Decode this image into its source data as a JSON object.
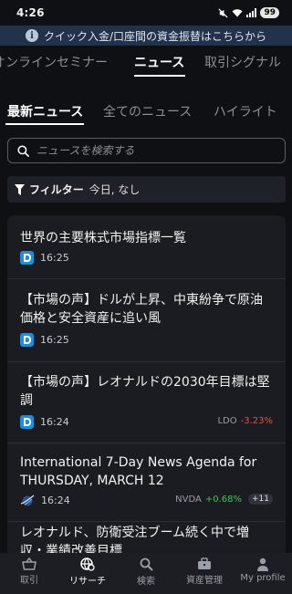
{
  "status_bar": {
    "time": "4:26",
    "battery": "99"
  },
  "banner": {
    "text": "クイック入金/口座間の資金振替はこちらから",
    "icon": "info-icon"
  },
  "top_tabs": [
    {
      "label": "オンラインセミナー"
    },
    {
      "label": "ニュース",
      "active": true
    },
    {
      "label": "取引シグナル"
    }
  ],
  "sub_tabs": [
    {
      "label": "最新ニュース",
      "active": true
    },
    {
      "label": "全てのニュース"
    },
    {
      "label": "ハイライト"
    }
  ],
  "search": {
    "placeholder": "ニュースを検索する"
  },
  "filter": {
    "label": "フィルター",
    "value": "今日, なし"
  },
  "news": [
    {
      "title": "世界の主要株式市場指標一覧",
      "time": "16:25",
      "source_icon": "news-source-icon"
    },
    {
      "title": "【市場の声】ドルが上昇、中東紛争で原油価格と安全資産に追い風",
      "time": "16:25",
      "source_icon": "news-source-icon"
    },
    {
      "title": "【市場の声】レオナルドの2030年目標は堅調",
      "time": "16:24",
      "source_icon": "news-source-icon",
      "ticker": "LDO",
      "change": "-3.23%"
    },
    {
      "title": "International 7-Day News Agenda for THURSDAY, MARCH 12",
      "time": "16:24",
      "source_icon": "globe-source-icon",
      "ticker": "NVDA",
      "change": "+0.68%",
      "more": "+11"
    },
    {
      "title": "レオナルド、防衛受注ブーム続く中で増収・業績改善目標"
    }
  ],
  "bottom_nav": [
    {
      "label": "取引",
      "icon": "basket-icon"
    },
    {
      "label": "リサーチ",
      "icon": "research-globe-icon",
      "active": true
    },
    {
      "label": "検索",
      "icon": "search-icon"
    },
    {
      "label": "資産管理",
      "icon": "briefcase-icon"
    },
    {
      "label": "My profile",
      "icon": "person-icon"
    }
  ],
  "colors": {
    "background": "#0f1013",
    "banner": "#22324a",
    "negative": "#e05252",
    "positive": "#43c15a",
    "source_icon": "#1f8fd8"
  }
}
